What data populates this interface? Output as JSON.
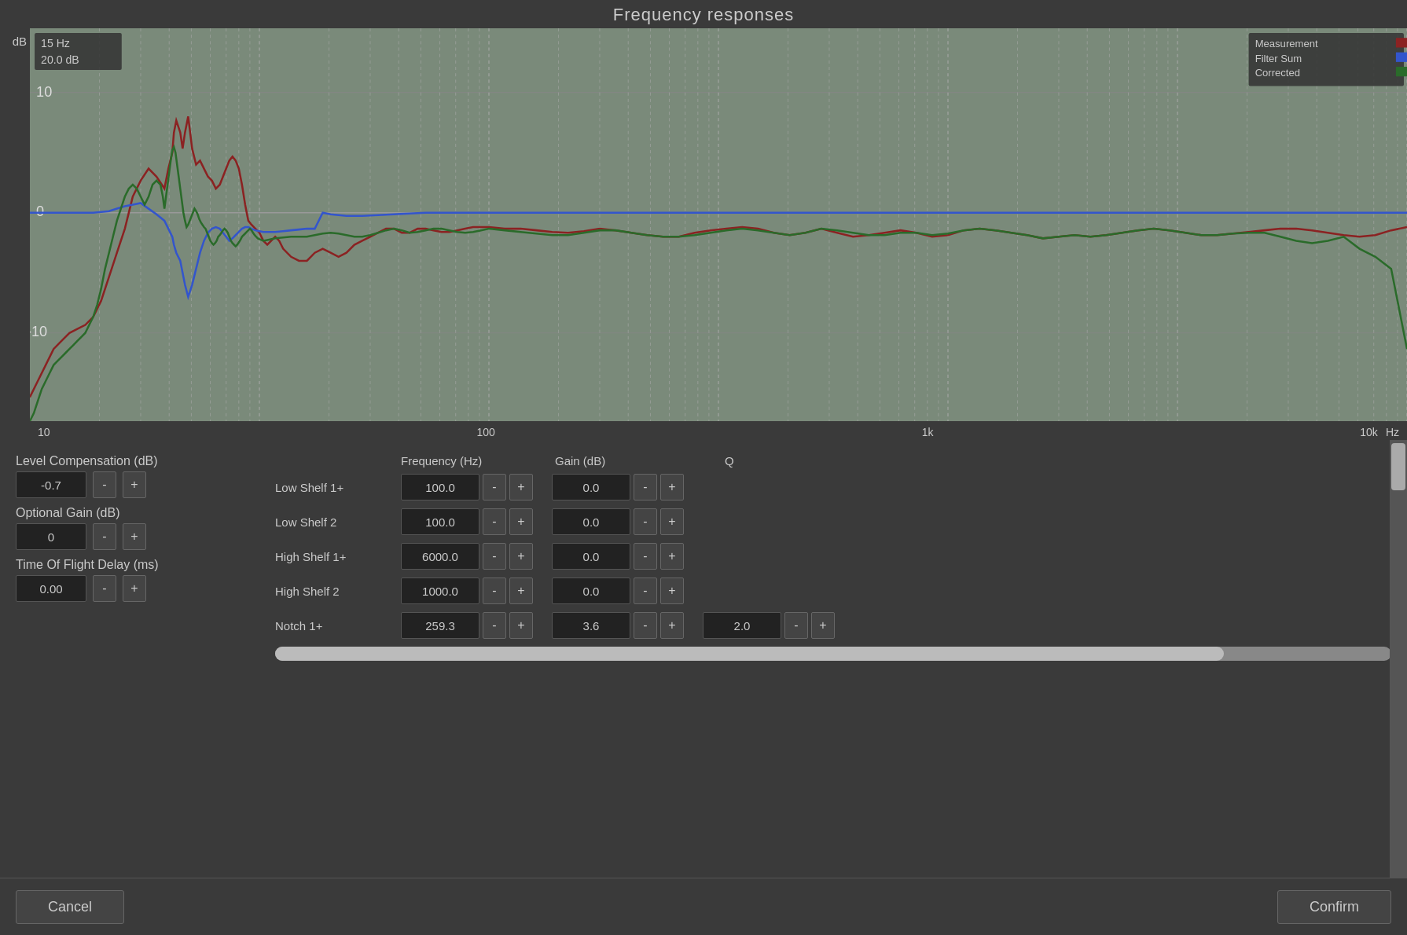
{
  "title": "Frequency responses",
  "chart": {
    "y_axis_label": "dB",
    "x_axis_labels": [
      "10",
      "100",
      "1k",
      "10k"
    ],
    "hz_label": "Hz",
    "info": {
      "line1": "15 Hz",
      "line2": "20.0 dB"
    },
    "legend": {
      "measurement_label": "Measurement",
      "filter_sum_label": "Filter Sum",
      "corrected_label": "Corrected",
      "measurement_color": "#8B2222",
      "filter_sum_color": "#2244AA",
      "corrected_color": "#2A6B2A"
    },
    "grid_lines_db": [
      "10",
      "0",
      "-10"
    ],
    "db_labels": [
      "10",
      "0",
      "-10"
    ]
  },
  "left_controls": {
    "level_comp_label": "Level Compensation (dB)",
    "level_comp_value": "-0.7",
    "level_comp_minus": "-",
    "level_comp_plus": "+",
    "opt_gain_label": "Optional Gain (dB)",
    "opt_gain_value": "0",
    "opt_gain_minus": "-",
    "opt_gain_plus": "+",
    "tof_label": "Time Of Flight Delay (ms)",
    "tof_value": "0.00",
    "tof_minus": "-",
    "tof_plus": "+"
  },
  "filter_headers": {
    "freq_label": "Frequency (Hz)",
    "gain_label": "Gain (dB)",
    "q_label": "Q"
  },
  "filters": [
    {
      "name": "Low Shelf 1+",
      "freq": "100.0",
      "freq_minus": "-",
      "freq_plus": "+",
      "gain": "0.0",
      "gain_minus": "-",
      "gain_plus": "+",
      "q": null,
      "q_minus": null,
      "q_plus": null
    },
    {
      "name": "Low Shelf 2",
      "freq": "100.0",
      "freq_minus": "-",
      "freq_plus": "+",
      "gain": "0.0",
      "gain_minus": "-",
      "gain_plus": "+",
      "q": null,
      "q_minus": null,
      "q_plus": null
    },
    {
      "name": "High Shelf 1+",
      "freq": "6000.0",
      "freq_minus": "-",
      "freq_plus": "+",
      "gain": "0.0",
      "gain_minus": "-",
      "gain_plus": "+",
      "q": null,
      "q_minus": null,
      "q_plus": null
    },
    {
      "name": "High Shelf 2",
      "freq": "1000.0",
      "freq_minus": "-",
      "freq_plus": "+",
      "gain": "0.0",
      "gain_minus": "-",
      "gain_plus": "+",
      "q": null,
      "q_minus": null,
      "q_plus": null
    },
    {
      "name": "Notch 1+",
      "freq": "259.3",
      "freq_minus": "-",
      "freq_plus": "+",
      "gain": "3.6",
      "gain_minus": "-",
      "gain_plus": "+",
      "q": "2.0",
      "q_minus": "-",
      "q_plus": "+"
    }
  ],
  "bottom_bar": {
    "cancel_label": "Cancel",
    "confirm_label": "Confirm"
  }
}
